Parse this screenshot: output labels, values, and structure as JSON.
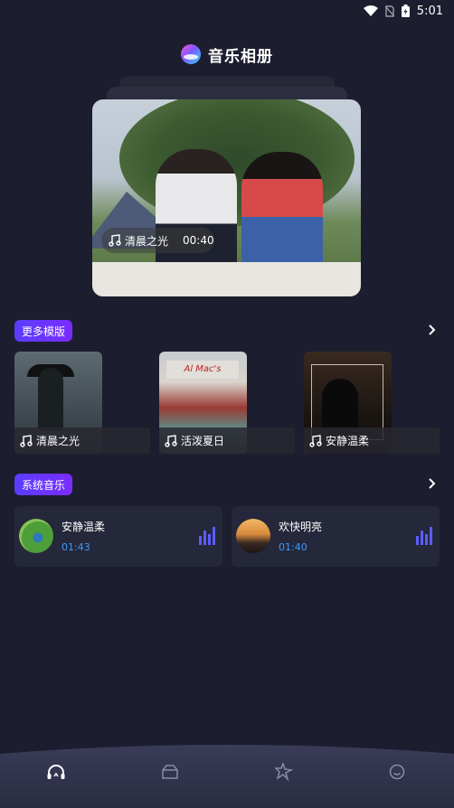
{
  "status_bar": {
    "time": "5:01"
  },
  "header": {
    "title": "音乐相册"
  },
  "hero": {
    "track": "清晨之光",
    "duration": "00:40"
  },
  "templates": {
    "section_label": "更多模版",
    "items": [
      {
        "label": "清晨之光"
      },
      {
        "label": "活泼夏日",
        "sign": "Al Mac's"
      },
      {
        "label": "安静温柔"
      }
    ]
  },
  "music": {
    "section_label": "系统音乐",
    "items": [
      {
        "title": "安静温柔",
        "duration": "01:43"
      },
      {
        "title": "欢快明亮",
        "duration": "01:40"
      }
    ]
  },
  "colors": {
    "background": "#1c1d2e",
    "accent": "#6a34ff",
    "duration_text": "#3a9cff",
    "card": "#25273a"
  },
  "nav": {
    "items": [
      {
        "icon": "music-home-icon",
        "active": true
      },
      {
        "icon": "box-icon",
        "active": false
      },
      {
        "icon": "sparkle-icon",
        "active": false
      },
      {
        "icon": "smile-icon",
        "active": false
      }
    ]
  }
}
